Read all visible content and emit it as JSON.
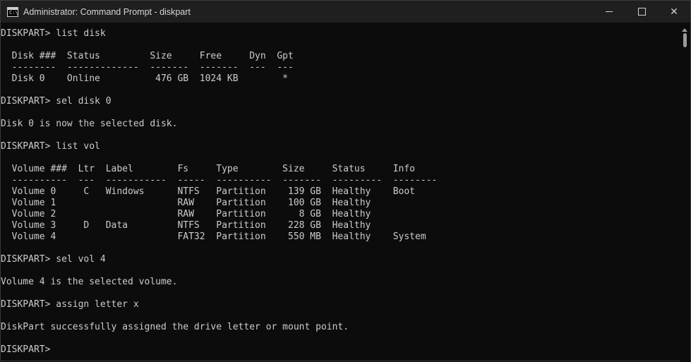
{
  "window": {
    "title": "Administrator: Command Prompt - diskpart",
    "icon": "console-app-icon",
    "icon_glyph": "C:\\",
    "controls": {
      "minimize": "minimize-icon",
      "maximize": "maximize-icon",
      "close": "✕"
    }
  },
  "console": {
    "lines": [
      "DISKPART> list disk",
      "",
      "  Disk ###  Status         Size     Free     Dyn  Gpt",
      "  --------  -------------  -------  -------  ---  ---",
      "  Disk 0    Online          476 GB  1024 KB        *",
      "",
      "DISKPART> sel disk 0",
      "",
      "Disk 0 is now the selected disk.",
      "",
      "DISKPART> list vol",
      "",
      "  Volume ###  Ltr  Label        Fs     Type        Size     Status     Info",
      "  ----------  ---  -----------  -----  ----------  -------  ---------  --------",
      "  Volume 0     C   Windows      NTFS   Partition    139 GB  Healthy    Boot",
      "  Volume 1                      RAW    Partition    100 GB  Healthy",
      "  Volume 2                      RAW    Partition      8 GB  Healthy",
      "  Volume 3     D   Data         NTFS   Partition    228 GB  Healthy",
      "  Volume 4                      FAT32  Partition    550 MB  Healthy    System",
      "",
      "DISKPART> sel vol 4",
      "",
      "Volume 4 is the selected volume.",
      "",
      "DISKPART> assign letter x",
      "",
      "DiskPart successfully assigned the drive letter or mount point.",
      "",
      "DISKPART> "
    ]
  },
  "colors": {
    "background": "#0c0c0c",
    "titlebar": "#1f1f1f",
    "text": "#cccccc"
  }
}
